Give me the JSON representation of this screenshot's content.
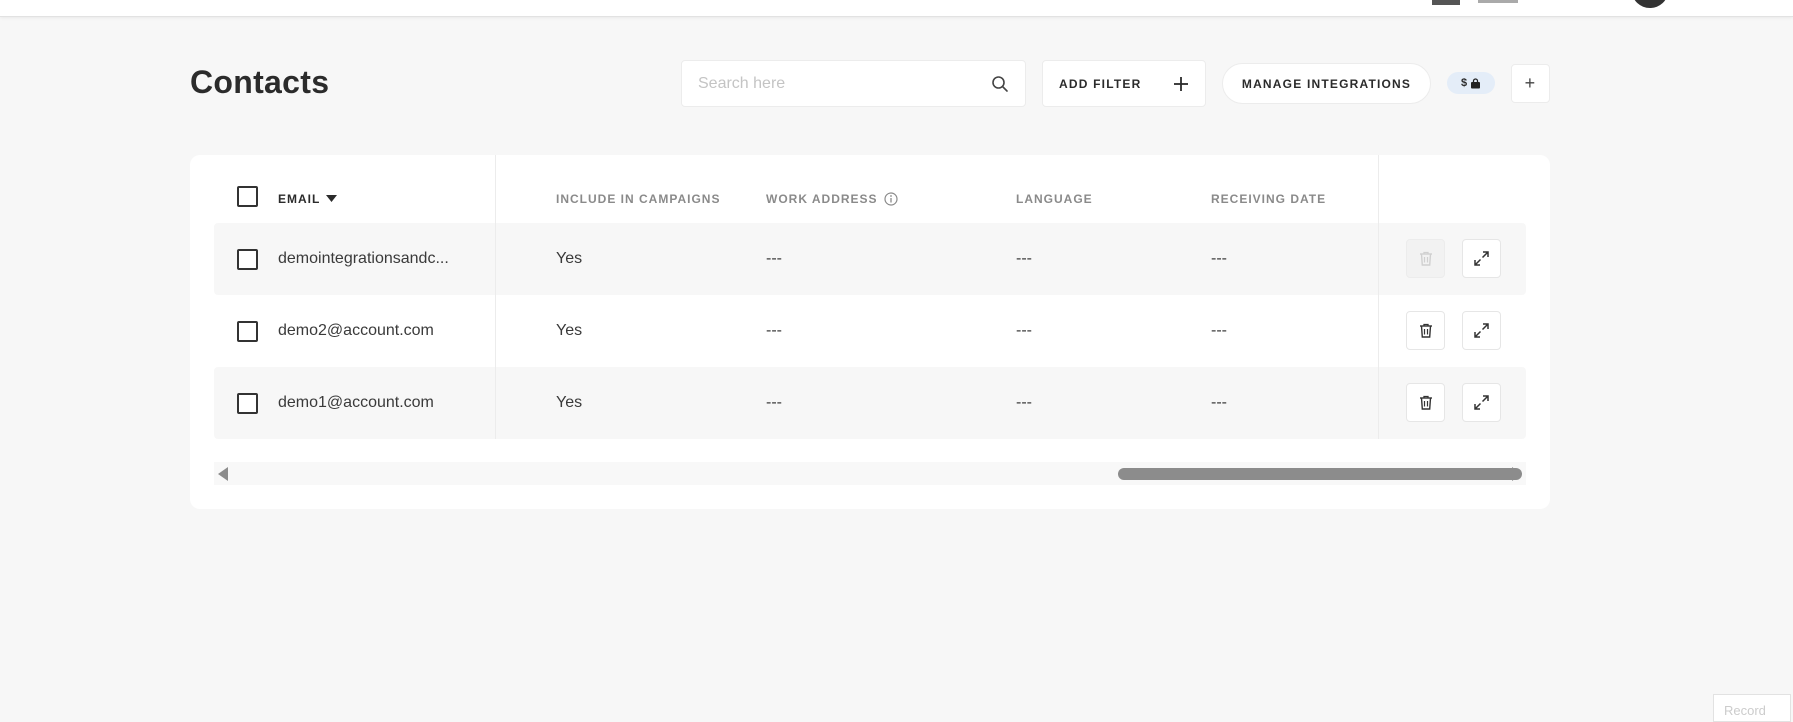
{
  "page": {
    "title": "Contacts"
  },
  "toolbar": {
    "search_placeholder": "Search here",
    "add_filter_label": "ADD FILTER",
    "manage_integrations_label": "MANAGE INTEGRATIONS",
    "badge_label": "$",
    "plus_label": "+"
  },
  "table": {
    "columns": {
      "email": "EMAIL",
      "include_in_campaigns": "INCLUDE IN CAMPAIGNS",
      "work_address": "WORK ADDRESS",
      "language": "LANGUAGE",
      "receiving_date": "RECEIVING DATE"
    },
    "rows": [
      {
        "email": "demointegrationsandc...",
        "include": "Yes",
        "work_address": "---",
        "language": "---",
        "receiving_date": "---",
        "delete_disabled": true
      },
      {
        "email": "demo2@account.com",
        "include": "Yes",
        "work_address": "---",
        "language": "---",
        "receiving_date": "---",
        "delete_disabled": false
      },
      {
        "email": "demo1@account.com",
        "include": "Yes",
        "work_address": "---",
        "language": "---",
        "receiving_date": "---",
        "delete_disabled": false
      }
    ]
  },
  "footer": {
    "corner_label": "Record"
  },
  "colors": {
    "background": "#f7f7f7",
    "card": "#ffffff",
    "badge": "#e4edf8",
    "scroll_thumb": "#8c8c8c"
  }
}
